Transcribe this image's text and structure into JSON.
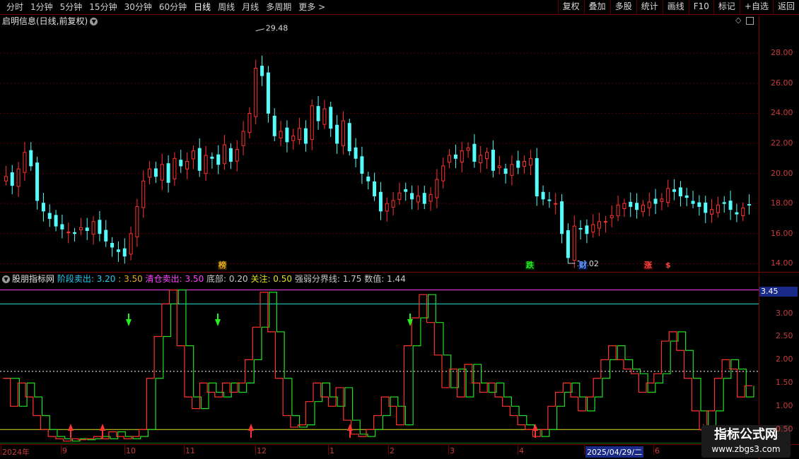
{
  "toolbar": {
    "left": [
      "分时",
      "1分钟",
      "5分钟",
      "15分钟",
      "30分钟",
      "60分钟",
      "日线",
      "周线",
      "月线",
      "多周期",
      "更多 >"
    ],
    "right": [
      "复权",
      "叠加",
      "多股",
      "统计",
      "画线",
      "F10",
      "标记",
      "+自选",
      "返回"
    ]
  },
  "main_panel": {
    "title": "启明信息(日线,前复权)",
    "yaxis": [
      "28.00",
      "26.00",
      "24.00",
      "22.00",
      "20.00",
      "18.00",
      "16.00",
      "14.00"
    ],
    "high_label": "29.48",
    "low_label": "14.02",
    "marks": [
      "榜",
      "跌",
      "财",
      "涨",
      "$"
    ]
  },
  "indicator_panel": {
    "title": "股朋指标网",
    "params": [
      {
        "label": "阶段卖出:",
        "value": "3.20"
      },
      {
        "label": ":",
        "value": "3.50"
      },
      {
        "label": "清仓卖出:",
        "value": "3.50"
      },
      {
        "label": "底部:",
        "value": "0.20"
      },
      {
        "label": "关注:",
        "value": "0.50"
      },
      {
        "label": "强弱分界线:",
        "value": "1.75"
      },
      {
        "label": "数值:",
        "value": "1.44"
      }
    ],
    "yaxis": [
      "3.00",
      "2.50",
      "2.00",
      "1.50",
      "1.00",
      "0.50"
    ],
    "current_value": "3.45"
  },
  "xaxis": {
    "labels": [
      "2024年",
      "9",
      "10",
      "11",
      "12",
      "1",
      "2",
      "3",
      "4",
      "2025/04/29/二",
      "6"
    ]
  },
  "watermark": {
    "line1": "指标公式网",
    "line2": "www.zbgs3.com"
  },
  "colors": {
    "up": "#ff3232",
    "down": "#54fcfc",
    "grid": "#7a0000",
    "axis_text": "#c83c3c",
    "green_line": "#22dd22"
  },
  "chart_data": [
    {
      "type": "candlestick",
      "title": "启明信息(日线,前复权)",
      "ylim": [
        13.5,
        30.5
      ],
      "close": [
        19.8,
        19.2,
        20.3,
        21.4,
        20.5,
        18.2,
        17.5,
        17.0,
        16.5,
        16.3,
        16.1,
        16.0,
        16.4,
        16.2,
        16.8,
        16.0,
        15.5,
        15.1,
        14.8,
        14.5,
        16.0,
        17.8,
        19.5,
        20.3,
        19.8,
        20.6,
        19.4,
        21.0,
        20.5,
        20.8,
        21.5,
        20.2,
        21.2,
        21.0,
        20.6,
        21.9,
        20.8,
        21.6,
        22.8,
        24.0,
        27.0,
        26.5,
        24.0,
        22.5,
        22.8,
        22.1,
        22.5,
        23.0,
        22.0,
        24.5,
        23.5,
        24.3,
        23.0,
        22.0,
        23.5,
        21.5,
        21.0,
        20.0,
        19.5,
        18.5,
        17.5,
        18.0,
        18.2,
        18.7,
        18.8,
        18.3,
        18.5,
        18.0,
        18.6,
        19.6,
        20.5,
        21.2,
        21.0,
        21.5,
        21.7,
        20.8,
        21.2,
        21.4,
        20.2,
        20.5,
        20.0,
        20.6,
        20.4,
        20.8,
        21.0,
        18.5,
        18.3,
        18.2,
        18.0,
        16.0,
        14.4,
        16.5,
        16.3,
        16.0,
        16.6,
        16.8,
        16.8,
        17.2,
        17.9,
        18.0,
        17.8,
        17.6,
        17.9,
        18.1,
        18.0,
        18.3,
        19.0,
        18.8,
        18.5,
        18.4,
        18.0,
        17.8,
        17.4,
        17.6,
        17.9,
        18.0,
        17.6,
        17.3,
        17.7,
        17.9
      ]
    },
    {
      "type": "line",
      "title": "股朋指标网",
      "ylim": [
        0.2,
        3.6
      ],
      "series": [
        {
          "name": "阶段卖出",
          "values": [
            3.2
          ]
        },
        {
          "name": "清仓卖出",
          "values": [
            3.5
          ]
        },
        {
          "name": "底部",
          "values": [
            0.2
          ]
        },
        {
          "name": "关注",
          "values": [
            0.5
          ]
        },
        {
          "name": "强弱分界线",
          "values": [
            1.75
          ]
        },
        {
          "name": "数值",
          "values": [
            1.6,
            1.0,
            1.5,
            1.2,
            0.8,
            0.5,
            0.35,
            0.3,
            0.25,
            0.3,
            0.28,
            0.3,
            0.35,
            0.3,
            0.45,
            0.35,
            0.3,
            0.35,
            0.5,
            1.6,
            2.5,
            3.2,
            3.5,
            2.3,
            1.2,
            0.95,
            1.5,
            1.3,
            1.2,
            1.5,
            1.3,
            1.5,
            2.0,
            2.7,
            3.45,
            2.6,
            1.6,
            0.8,
            0.55,
            0.6,
            1.1,
            1.5,
            1.2,
            1.0,
            1.4,
            0.7,
            0.4,
            0.35,
            0.5,
            0.8,
            1.2,
            1.0,
            0.6,
            2.3,
            2.9,
            3.4,
            2.8,
            2.1,
            1.4,
            1.8,
            1.2,
            1.9,
            1.5,
            1.3,
            1.5,
            1.2,
            1.0,
            0.8,
            0.6,
            0.5,
            0.35,
            0.5,
            1.0,
            1.3,
            1.5,
            1.2,
            0.9,
            1.2,
            1.6,
            2.0,
            2.3,
            2.0,
            1.8,
            1.7,
            1.3,
            1.5,
            1.7,
            2.4,
            2.6,
            2.2,
            1.6,
            0.9,
            0.5,
            0.9,
            1.6,
            2.0,
            1.8,
            1.2,
            1.44
          ]
        }
      ]
    }
  ]
}
